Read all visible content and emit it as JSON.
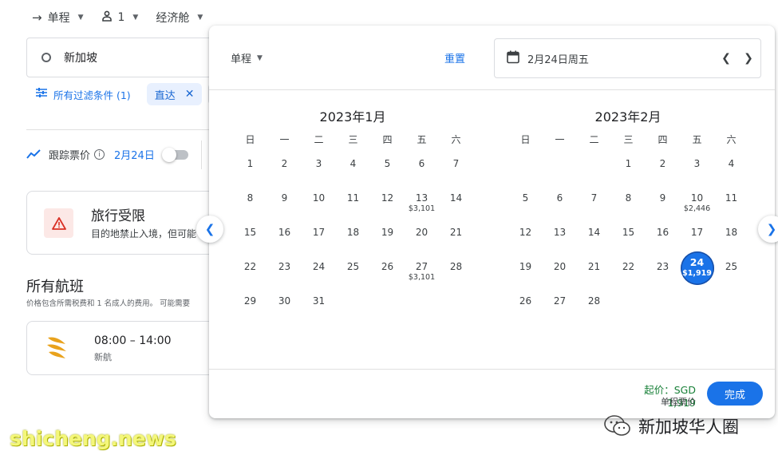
{
  "topbar": {
    "trip_type": "单程",
    "passengers": "1",
    "cabin": "经济舱"
  },
  "origin": {
    "value": "新加坡"
  },
  "filters": {
    "all_filters": "所有过滤条件 (1)",
    "chip_label": "直达"
  },
  "track": {
    "label": "跟踪票价",
    "info": "i",
    "date": "2月24日"
  },
  "alert": {
    "title": "旅行受限",
    "text": "目的地禁止入境，但可能"
  },
  "flights": {
    "heading": "所有航班",
    "subtext": "价格包含所需税费和 1 名成人的费用。 可能需要",
    "items": [
      {
        "time": "08:00 – 14:00",
        "airline": "新航"
      }
    ]
  },
  "popup": {
    "trip_type": "单程",
    "reset": "重置",
    "selected_date": "2月24日周五",
    "weekdays": [
      "日",
      "一",
      "二",
      "三",
      "四",
      "五",
      "六"
    ],
    "months": [
      {
        "title": "2023年1月",
        "days": [
          {
            "d": "1"
          },
          {
            "d": "2"
          },
          {
            "d": "3"
          },
          {
            "d": "4"
          },
          {
            "d": "5"
          },
          {
            "d": "6"
          },
          {
            "d": "7"
          },
          {
            "d": "8"
          },
          {
            "d": "9"
          },
          {
            "d": "10"
          },
          {
            "d": "11"
          },
          {
            "d": "12"
          },
          {
            "d": "13",
            "p": "$3,101"
          },
          {
            "d": "14"
          },
          {
            "d": "15"
          },
          {
            "d": "16"
          },
          {
            "d": "17"
          },
          {
            "d": "18"
          },
          {
            "d": "19"
          },
          {
            "d": "20"
          },
          {
            "d": "21"
          },
          {
            "d": "22"
          },
          {
            "d": "23"
          },
          {
            "d": "24"
          },
          {
            "d": "25"
          },
          {
            "d": "26"
          },
          {
            "d": "27",
            "p": "$3,101"
          },
          {
            "d": "28"
          },
          {
            "d": "29"
          },
          {
            "d": "30"
          },
          {
            "d": "31"
          }
        ]
      },
      {
        "title": "2023年2月",
        "days": [
          {
            "d": ""
          },
          {
            "d": ""
          },
          {
            "d": ""
          },
          {
            "d": "1"
          },
          {
            "d": "2"
          },
          {
            "d": "3"
          },
          {
            "d": "4"
          },
          {
            "d": "5"
          },
          {
            "d": "6"
          },
          {
            "d": "7"
          },
          {
            "d": "8"
          },
          {
            "d": "9"
          },
          {
            "d": "10",
            "p": "$2,446"
          },
          {
            "d": "11"
          },
          {
            "d": "12"
          },
          {
            "d": "13"
          },
          {
            "d": "14"
          },
          {
            "d": "15"
          },
          {
            "d": "16"
          },
          {
            "d": "17"
          },
          {
            "d": "18"
          },
          {
            "d": "19"
          },
          {
            "d": "20"
          },
          {
            "d": "21"
          },
          {
            "d": "22"
          },
          {
            "d": "23"
          },
          {
            "d": "24",
            "p": "$1,919",
            "selected": true
          },
          {
            "d": "25"
          },
          {
            "d": "26"
          },
          {
            "d": "27"
          },
          {
            "d": "28"
          }
        ]
      }
    ],
    "from_price": "起价：SGD 1,919",
    "from_sub": "单程票价",
    "done": "完成"
  },
  "watermark": {
    "right": "新加坡华人圈",
    "left": "shicheng.news"
  },
  "colors": {
    "accent": "#1a73e8",
    "price_green": "#188038",
    "alert_red": "#d93025",
    "selected": "#1a73e8"
  }
}
